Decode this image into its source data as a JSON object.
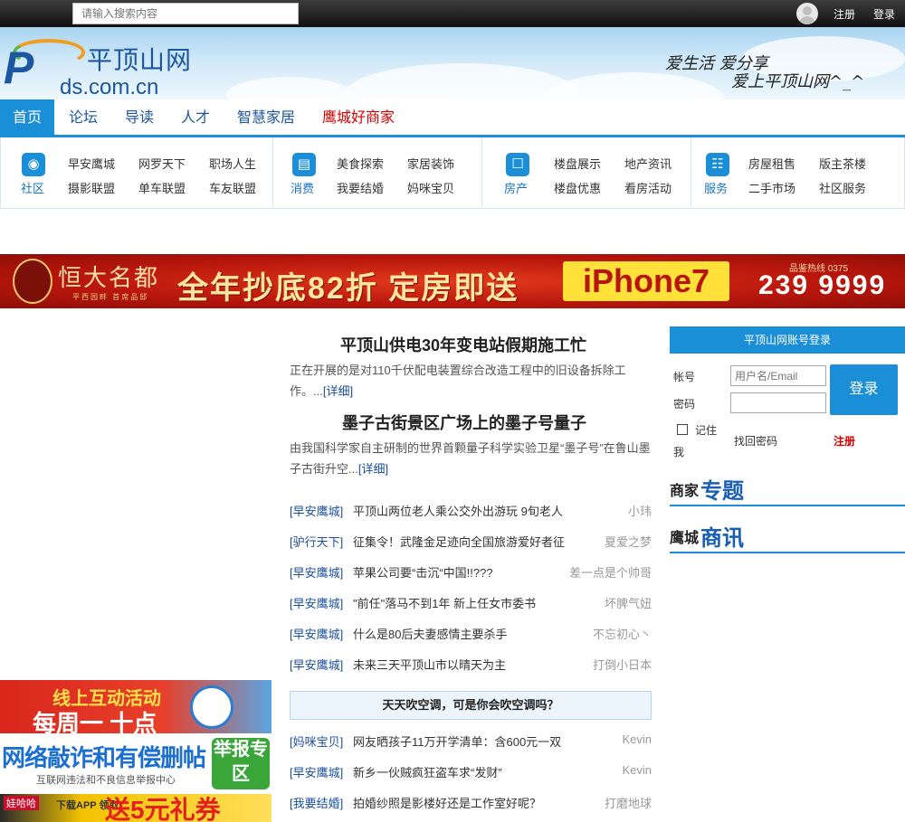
{
  "topbar": {
    "search_placeholder": "请输入搜索内容",
    "register": "注册",
    "login": "登录"
  },
  "header": {
    "logo_name": "平顶山网",
    "logo_domain": "ds.com.cn",
    "logo_letter": "P",
    "slogan_line1": "爱生活 爱分享",
    "slogan_line2": "爱上平顶山网^_^"
  },
  "nav": {
    "items": [
      "首页",
      "论坛",
      "导读",
      "人才",
      "智慧家居",
      "鹰城好商家"
    ]
  },
  "categories": [
    {
      "label": "社区",
      "icon": "chat-icon",
      "links": [
        "早安鹰城",
        "网罗天下",
        "职场人生",
        "摄影联盟",
        "单车联盟",
        "车友联盟"
      ]
    },
    {
      "label": "消费",
      "icon": "cart-icon",
      "links": [
        "美食探索",
        "家居装饰",
        "我要结婚",
        "妈咪宝贝"
      ]
    },
    {
      "label": "房产",
      "icon": "gift-icon",
      "links": [
        "楼盘展示",
        "地产资讯",
        "楼盘优惠",
        "看房活动"
      ]
    },
    {
      "label": "服务",
      "icon": "service-icon",
      "links": [
        "房屋租售",
        "版主茶楼",
        "二手市场",
        "社区服务"
      ]
    }
  ],
  "banner": {
    "brand": "恒大名都",
    "brand_sub": "平西园畔 首席品邸",
    "main_text": "全年抄底82折 定房即送",
    "phone_text": "iPhone7",
    "hotline_label": "品鉴热线 0375",
    "hotline_number": "239 9999"
  },
  "headlines": [
    {
      "title": "平顶山供电30年变电站假期施工忙",
      "summary": "正在开展的是对110千伏配电装置综合改造工程中的旧设备拆除工作。...",
      "more": "[详细]"
    },
    {
      "title": "墨子古街景区广场上的墨子号量子",
      "summary": "由我国科学家自主研制的世界首颗量子科学实验卫星“墨子号”在鲁山墨子古街升空...",
      "more": "[详细]"
    }
  ],
  "news_list": [
    {
      "category": "[早安鹰城]",
      "title": "平顶山两位老人乘公交外出游玩 9旬老人",
      "author": "小玮"
    },
    {
      "category": "[驴行天下]",
      "title": "征集令！武隆金足迹向全国旅游爱好者征",
      "author": "夏爱之梦"
    },
    {
      "category": "[早安鹰城]",
      "title": "苹果公司要“击沉“中国!!???",
      "author": "差一点是个帅哥"
    },
    {
      "category": "[早安鹰城]",
      "title": "\"前任\"落马不到1年 新上任女市委书",
      "author": "坏脾气妞"
    },
    {
      "category": "[早安鹰城]",
      "title": "什么是80后夫妻感情主要杀手",
      "author": "不忘初心丶"
    },
    {
      "category": "[早安鹰城]",
      "title": "未来三天平顶山市以晴天为主",
      "author": "打倒小日本"
    }
  ],
  "topic": {
    "title": "天天吹空调，可是你会吹空调吗？"
  },
  "news_list2": [
    {
      "category": "[妈咪宝贝]",
      "title": "网友晒孩子11万开学清单：含600元一双",
      "author": "Kevin"
    },
    {
      "category": "[早安鹰城]",
      "title": "新乡一伙贼疯狂盗车求“发财”",
      "author": "Kevin"
    },
    {
      "category": "[我要结婚]",
      "title": "拍婚纱照是影楼好还是工作室好呢？",
      "author": "打磨地球"
    }
  ],
  "ads": {
    "ad1_line1": "线上互动活动",
    "ad1_line2": "每周一 十点",
    "ad2_line1": "网络敲诈和有偿删帖",
    "ad2_line2": "互联网违法和不良信息举报中心",
    "ad2_box": "举报专区",
    "ad3_brand": "娃哈哈",
    "ad3_text": "下载APP 领取",
    "ad3_big": "送5元礼券"
  },
  "login": {
    "header": "平顶山网账号登录",
    "account_label": "帐号",
    "password_label": "密码",
    "account_placeholder": "用户名/Email",
    "button": "登录",
    "remember_line1": "记住",
    "remember_line2": "我",
    "forgot": "找回密码",
    "register": "注册"
  },
  "sections": [
    {
      "small": "商家",
      "big": "专题"
    },
    {
      "small": "鹰城",
      "big": "商讯"
    }
  ],
  "colors": {
    "primary_blue": "#1a8fd8",
    "link_blue": "#1a4fa0",
    "accent_red": "#d40000"
  }
}
